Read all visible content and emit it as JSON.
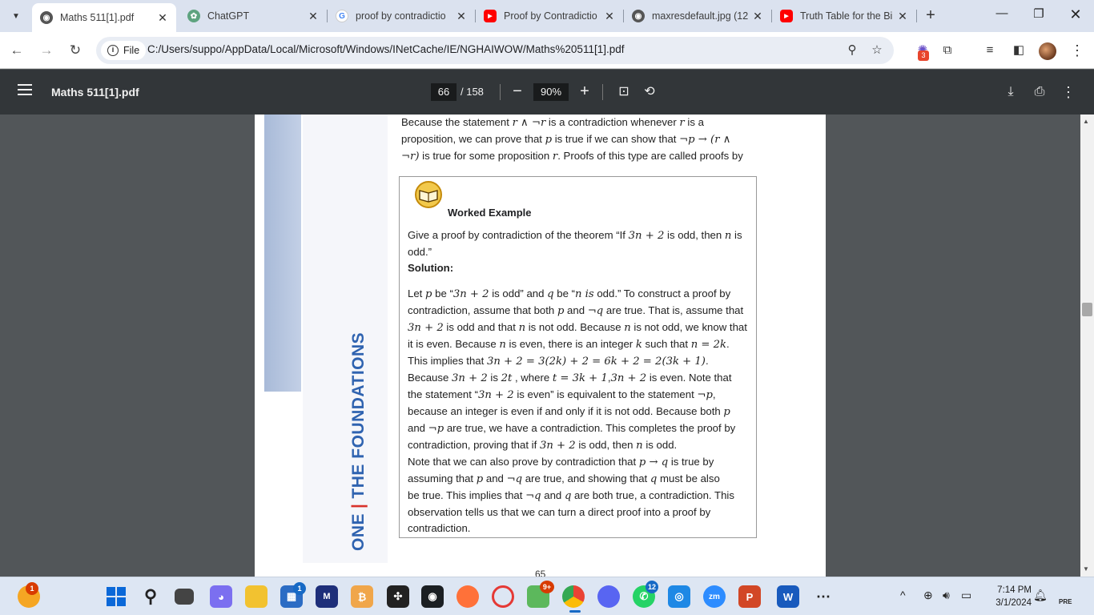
{
  "tabs": [
    {
      "title": "Maths 511[1].pdf",
      "icon": "globe-icon",
      "active": true
    },
    {
      "title": "ChatGPT",
      "icon": "chatgpt-icon"
    },
    {
      "title": "proof by contradictio",
      "icon": "google-icon"
    },
    {
      "title": "Proof by Contradictio",
      "icon": "youtube-icon"
    },
    {
      "title": "maxresdefault.jpg (12",
      "icon": "globe-icon"
    },
    {
      "title": "Truth Table for the Bi",
      "icon": "youtube-icon"
    }
  ],
  "address": {
    "chip": "File",
    "url": "C:/Users/suppo/AppData/Local/Microsoft/Windows/INetCache/IE/NGHAIWOW/Maths%20511[1].pdf",
    "extension_badge": "3"
  },
  "pdf_toolbar": {
    "title": "Maths 511[1].pdf",
    "current_page": "66",
    "total_pages": "/ 158",
    "zoom": "90%"
  },
  "document": {
    "side_title_1": "ONE",
    "side_title_sep": "|",
    "side_title_2": "THE FOUNDATIONS",
    "intro": [
      [
        "Because the statement ",
        "m:r ∧ ¬r",
        " is a contradiction whenever ",
        "m:r",
        " is a"
      ],
      [
        "proposition, we can prove that ",
        "m:p",
        " is true if we can show that ",
        "m:¬p → (r ∧"
      ],
      [
        "m:¬r)",
        " is true for some proposition ",
        "m:r",
        ". Proofs of this type are called proofs by"
      ]
    ],
    "example_heading": "Worked Example",
    "question": [
      [
        "Give a proof by contradiction of the theorem “If ",
        "m:3n + 2",
        " is odd, then ",
        "m:n",
        " is"
      ],
      [
        "odd.”"
      ]
    ],
    "solution_label": "Solution:",
    "body": [
      [
        "Let ",
        "m:p",
        " be “",
        "m:3n + 2",
        " is odd” and ",
        "m:q",
        " be “",
        "m:n is",
        " odd.” To construct a proof by"
      ],
      [
        "contradiction, assume that both ",
        "m:p",
        " and ",
        "m:¬q",
        " are true. That is, assume that"
      ],
      [
        "m:3n + 2",
        " is odd and that ",
        "m:n",
        " is not odd. Because ",
        "m:n",
        " is not odd, we know that"
      ],
      [
        "it is even. Because ",
        "m:n",
        " is even, there is an integer       ",
        "m:k",
        " such that ",
        "m:n = 2k",
        "."
      ],
      [
        "This implies that ",
        "m:3n + 2 = 3(2k) + 2 = 6k + 2 = 2(3k + 1)",
        "."
      ],
      [
        "Because ",
        "m:3n + 2",
        " is ",
        "m:2t",
        " , where ",
        "m:t = 3k + 1",
        ",",
        "m:3n + 2",
        " is even. Note that"
      ],
      [
        "the statement “",
        "m:3n + 2",
        " is even” is equivalent to the statement ",
        "m:¬p",
        ","
      ],
      [
        "because an integer is even if and only if it is not odd. Because both ",
        "m:p"
      ],
      [
        "and ",
        "m:¬p",
        " are true, we have a contradiction. This completes the proof by"
      ],
      [
        "contradiction, proving that if ",
        "m:3n + 2",
        " is odd, then ",
        "m:n",
        " is odd."
      ],
      [
        "Note that we can also prove by contradiction that ",
        "m:p → q",
        " is true by"
      ],
      [
        "assuming that ",
        "m:p",
        " and ",
        "m:¬q",
        "       are true, and showing that ",
        "m:q",
        " must be also"
      ],
      [
        "be true. This implies that ",
        "m:¬q",
        " and ",
        "m:q",
        " are both true,  a contradiction. This"
      ],
      [
        "observation tells us that we can turn a direct proof into a proof by"
      ],
      [
        "contradiction."
      ]
    ],
    "page_number": "65"
  },
  "taskbar": {
    "notification_badge": "1",
    "store_badge": "1",
    "chrome_badge": "9+",
    "whatsapp_badge": "12",
    "time": "7:14 PM",
    "date": "3/1/2024",
    "pre_badge": "PRE"
  }
}
